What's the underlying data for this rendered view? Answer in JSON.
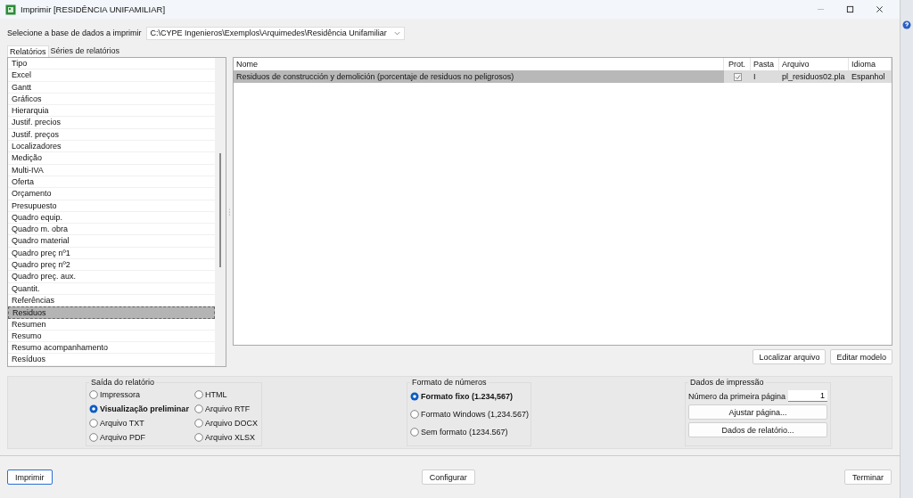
{
  "window": {
    "title": "Imprimir [RESIDÊNCIA UNIFAMILIAR]"
  },
  "database": {
    "label": "Selecione a base de dados a imprimir",
    "value": "C:\\CYPE Ingenieros\\Exemplos\\Arquimedes\\Residência Unifamiliar"
  },
  "tabs": [
    {
      "label": "Relatórios",
      "selected": true
    },
    {
      "label": "Séries de relatórios",
      "selected": false
    }
  ],
  "report_types": {
    "header": "Tipo",
    "items": [
      {
        "label": "Excel",
        "selected": false
      },
      {
        "label": "Gantt",
        "selected": false
      },
      {
        "label": "Gráficos",
        "selected": false
      },
      {
        "label": "Hierarquia",
        "selected": false
      },
      {
        "label": "Justif. precios",
        "selected": false
      },
      {
        "label": "Justif. preços",
        "selected": false
      },
      {
        "label": "Localizadores",
        "selected": false
      },
      {
        "label": "Medição",
        "selected": false
      },
      {
        "label": "Multi-IVA",
        "selected": false
      },
      {
        "label": "Oferta",
        "selected": false
      },
      {
        "label": "Orçamento",
        "selected": false
      },
      {
        "label": "Presupuesto",
        "selected": false
      },
      {
        "label": "Quadro equip.",
        "selected": false
      },
      {
        "label": "Quadro m. obra",
        "selected": false
      },
      {
        "label": "Quadro material",
        "selected": false
      },
      {
        "label": "Quadro preç nº1",
        "selected": false
      },
      {
        "label": "Quadro preç nº2",
        "selected": false
      },
      {
        "label": "Quadro preç. aux.",
        "selected": false
      },
      {
        "label": "Quantit.",
        "selected": false
      },
      {
        "label": "Referências",
        "selected": false
      },
      {
        "label": "Residuos",
        "selected": true
      },
      {
        "label": "Resumen",
        "selected": false
      },
      {
        "label": "Resumo",
        "selected": false
      },
      {
        "label": "Resumo acompanhamento",
        "selected": false
      },
      {
        "label": "Resíduos",
        "selected": false
      }
    ]
  },
  "reports": {
    "columns": [
      "Nome",
      "Prot.",
      "Pasta",
      "Arquivo",
      "Idioma"
    ],
    "rows": [
      {
        "name": "Residuos de construcción y demolición (porcentaje de residuos no peligrosos)",
        "protected": true,
        "folder": "I",
        "file": "pl_residuos02.pla",
        "language": "Espanhol",
        "selected": true
      }
    ]
  },
  "report_buttons": [
    "Localizar arquivo",
    "Editar modelo"
  ],
  "output": {
    "title": "Saída do relatório",
    "options": [
      {
        "label": "Impressora",
        "selected": false
      },
      {
        "label": "Visualização preliminar",
        "selected": true
      },
      {
        "label": "Arquivo TXT",
        "selected": false
      },
      {
        "label": "Arquivo PDF",
        "selected": false
      },
      {
        "label": "HTML",
        "selected": false
      },
      {
        "label": "Arquivo RTF",
        "selected": false
      },
      {
        "label": "Arquivo DOCX",
        "selected": false
      },
      {
        "label": "Arquivo XLSX",
        "selected": false
      }
    ]
  },
  "number_format": {
    "title": "Formato de números",
    "options": [
      {
        "label": "Formato fixo (1.234,567)",
        "selected": true
      },
      {
        "label": "Formato Windows (1,234.567)",
        "selected": false
      },
      {
        "label": "Sem formato (1234.567)",
        "selected": false
      }
    ]
  },
  "print_data": {
    "title": "Dados de impressão",
    "first_page_label": "Número da primeira página",
    "first_page_value": "1",
    "buttons": [
      "Ajustar página...",
      "Dados de relatório..."
    ]
  },
  "footer_buttons": [
    {
      "label": "Imprimir",
      "default": true
    },
    {
      "label": "Configurar",
      "default": false
    },
    {
      "label": "Terminar",
      "default": false
    }
  ]
}
